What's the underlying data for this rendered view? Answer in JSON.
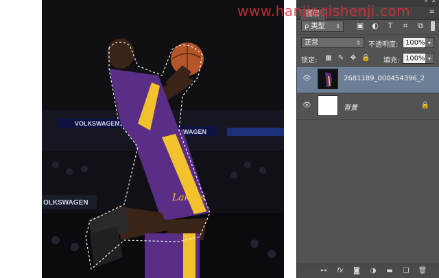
{
  "watermark": "www.hanjiaqishenji.com",
  "ad_boards": [
    "VOLKSWAGEN",
    "SWAGEN",
    "OLKSWAGEN"
  ],
  "photo_jersey_logo": "Lakers",
  "panel": {
    "tab_label": "图层",
    "filter_label": "ρ 类型",
    "blend_mode": "正常",
    "opacity_label": "不透明度:",
    "opacity_value": "100%",
    "lock_label": "锁定:",
    "fill_label": "填充:",
    "fill_value": "100%",
    "layers": [
      {
        "name": "2681189_000454396_2",
        "visible": true,
        "selected": true
      },
      {
        "name": "背景",
        "visible": true,
        "selected": false,
        "locked": true
      }
    ]
  },
  "icons": {
    "filter": [
      "image-filter-icon",
      "adjustment-filter-icon",
      "type-filter-icon",
      "shape-filter-icon",
      "smart-object-filter-icon"
    ],
    "lock": [
      "lock-transparent-icon",
      "lock-image-icon",
      "lock-position-icon",
      "lock-all-icon"
    ],
    "bottom": [
      "link-layers-icon",
      "fx-icon",
      "add-mask-icon",
      "adjustment-layer-icon",
      "new-group-icon",
      "new-layer-icon",
      "delete-layer-icon"
    ]
  },
  "colors": {
    "selected_layer": "#6d7f96",
    "panel_bg": "#535353",
    "jersey_purple": "#5a2d86",
    "jersey_gold": "#f1c22c",
    "watermark": "#e0303a"
  }
}
